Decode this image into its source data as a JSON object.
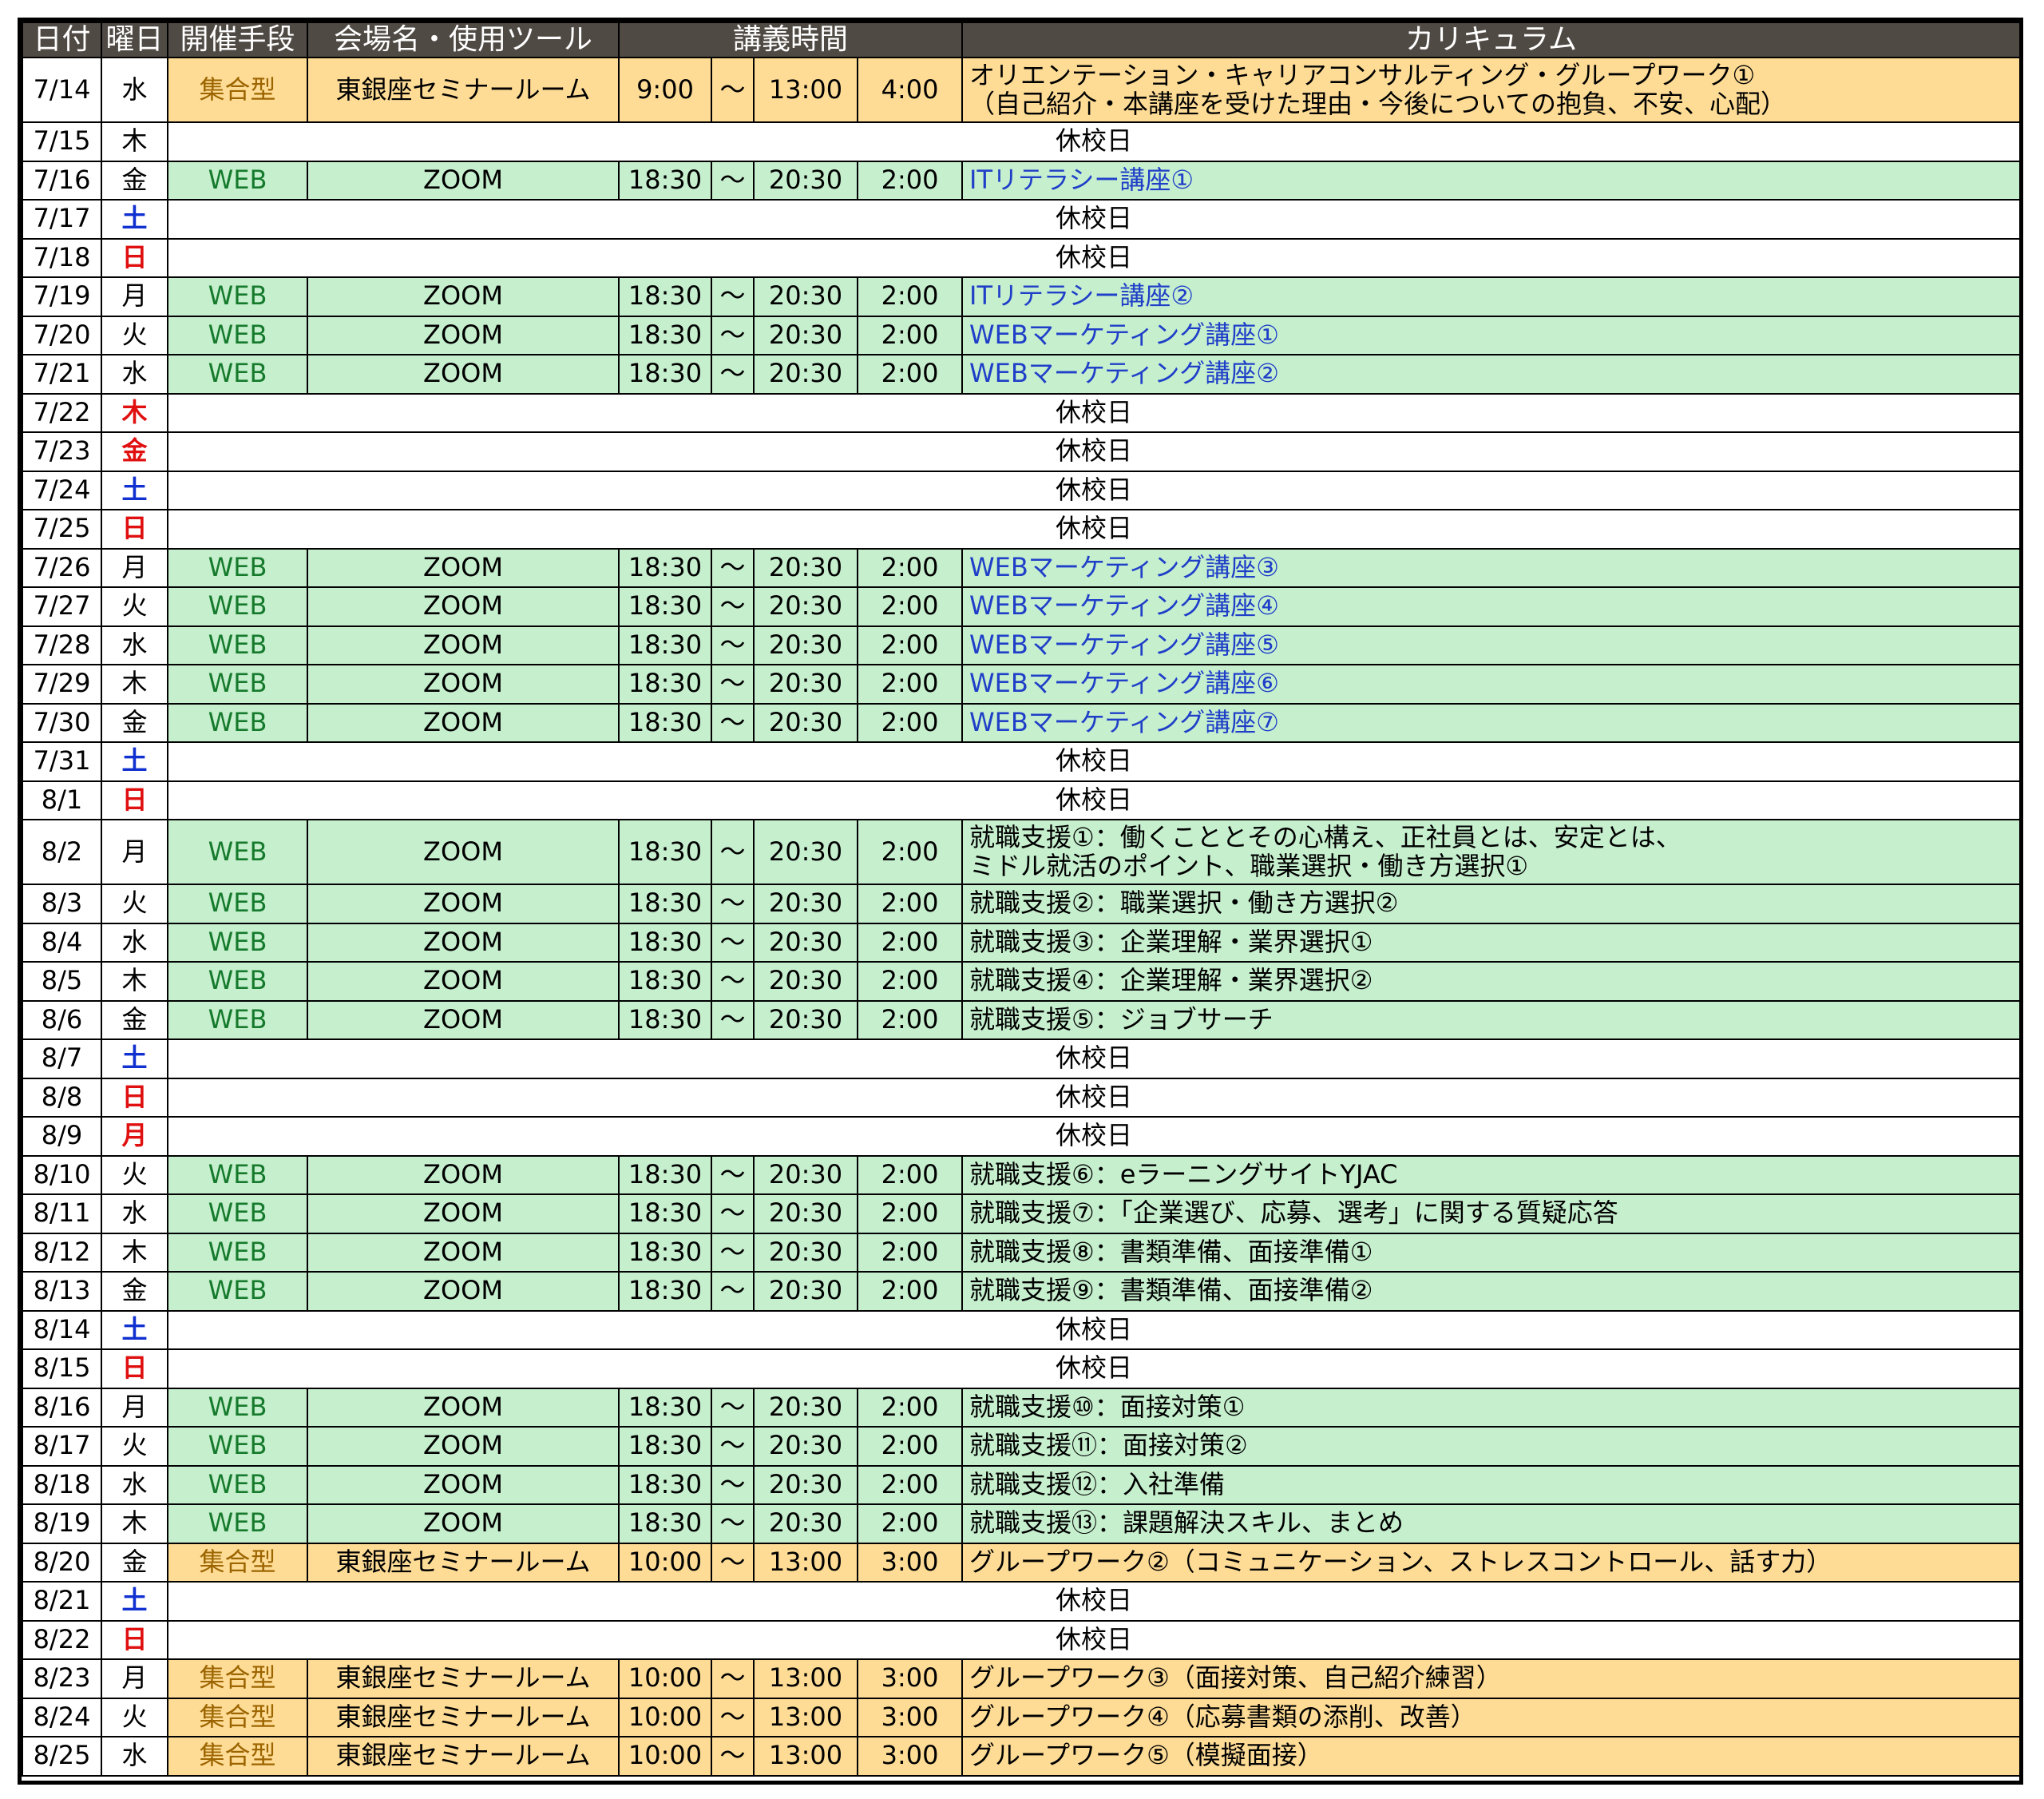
{
  "headers": {
    "date": "日付",
    "weekday": "曜日",
    "method": "開催手段",
    "venue": "会場名・使用ツール",
    "time": "講義時間",
    "curriculum": "カリキュラム"
  },
  "closed_label": "休校日",
  "tilde": "～",
  "colors": {
    "header_bg": "#504a44",
    "web_row": "#c6efce",
    "onsite_row": "#fedc96",
    "web_text": "#157a2c",
    "onsite_text": "#9c6500",
    "saturday": "#1030d0",
    "sunday_holiday": "#e01010",
    "course_link_text": "#1f3fc8"
  },
  "rows": [
    {
      "date": "7/14",
      "day": "水",
      "dayType": "weekday",
      "type": "onsite",
      "method": "集合型",
      "venue": "東銀座セミナールーム",
      "start": "9:00",
      "end": "13:00",
      "dur": "4:00",
      "cur": "オリエンテーション・キャリアコンサルティング・グループワーク①",
      "cur2": "（自己紹介・本講座を受けた理由・今後についての抱負、不安、心配）",
      "blue": false
    },
    {
      "date": "7/15",
      "day": "木",
      "dayType": "weekday",
      "type": "closed"
    },
    {
      "date": "7/16",
      "day": "金",
      "dayType": "weekday",
      "type": "web",
      "method": "WEB",
      "venue": "ZOOM",
      "start": "18:30",
      "end": "20:30",
      "dur": "2:00",
      "cur": "ITリテラシー講座①",
      "blue": true
    },
    {
      "date": "7/17",
      "day": "土",
      "dayType": "sat",
      "type": "closed"
    },
    {
      "date": "7/18",
      "day": "日",
      "dayType": "sun",
      "type": "closed"
    },
    {
      "date": "7/19",
      "day": "月",
      "dayType": "weekday",
      "type": "web",
      "method": "WEB",
      "venue": "ZOOM",
      "start": "18:30",
      "end": "20:30",
      "dur": "2:00",
      "cur": "ITリテラシー講座②",
      "blue": true
    },
    {
      "date": "7/20",
      "day": "火",
      "dayType": "weekday",
      "type": "web",
      "method": "WEB",
      "venue": "ZOOM",
      "start": "18:30",
      "end": "20:30",
      "dur": "2:00",
      "cur": "WEBマーケティング講座①",
      "blue": true
    },
    {
      "date": "7/21",
      "day": "水",
      "dayType": "weekday",
      "type": "web",
      "method": "WEB",
      "venue": "ZOOM",
      "start": "18:30",
      "end": "20:30",
      "dur": "2:00",
      "cur": "WEBマーケティング講座②",
      "blue": true
    },
    {
      "date": "7/22",
      "day": "木",
      "dayType": "holiday",
      "type": "closed"
    },
    {
      "date": "7/23",
      "day": "金",
      "dayType": "holiday",
      "type": "closed"
    },
    {
      "date": "7/24",
      "day": "土",
      "dayType": "sat",
      "type": "closed"
    },
    {
      "date": "7/25",
      "day": "日",
      "dayType": "sun",
      "type": "closed"
    },
    {
      "date": "7/26",
      "day": "月",
      "dayType": "weekday",
      "type": "web",
      "method": "WEB",
      "venue": "ZOOM",
      "start": "18:30",
      "end": "20:30",
      "dur": "2:00",
      "cur": "WEBマーケティング講座③",
      "blue": true
    },
    {
      "date": "7/27",
      "day": "火",
      "dayType": "weekday",
      "type": "web",
      "method": "WEB",
      "venue": "ZOOM",
      "start": "18:30",
      "end": "20:30",
      "dur": "2:00",
      "cur": "WEBマーケティング講座④",
      "blue": true
    },
    {
      "date": "7/28",
      "day": "水",
      "dayType": "weekday",
      "type": "web",
      "method": "WEB",
      "venue": "ZOOM",
      "start": "18:30",
      "end": "20:30",
      "dur": "2:00",
      "cur": "WEBマーケティング講座⑤",
      "blue": true
    },
    {
      "date": "7/29",
      "day": "木",
      "dayType": "weekday",
      "type": "web",
      "method": "WEB",
      "venue": "ZOOM",
      "start": "18:30",
      "end": "20:30",
      "dur": "2:00",
      "cur": "WEBマーケティング講座⑥",
      "blue": true
    },
    {
      "date": "7/30",
      "day": "金",
      "dayType": "weekday",
      "type": "web",
      "method": "WEB",
      "venue": "ZOOM",
      "start": "18:30",
      "end": "20:30",
      "dur": "2:00",
      "cur": "WEBマーケティング講座⑦",
      "blue": true
    },
    {
      "date": "7/31",
      "day": "土",
      "dayType": "sat",
      "type": "closed"
    },
    {
      "date": "8/1",
      "day": "日",
      "dayType": "sun",
      "type": "closed"
    },
    {
      "date": "8/2",
      "day": "月",
      "dayType": "weekday",
      "type": "web",
      "method": "WEB",
      "venue": "ZOOM",
      "start": "18:30",
      "end": "20:30",
      "dur": "2:00",
      "cur": "就職支援①：働くこととその心構え、正社員とは、安定とは、",
      "cur2": "ミドル就活のポイント、職業選択・働き方選択①",
      "blue": false
    },
    {
      "date": "8/3",
      "day": "火",
      "dayType": "weekday",
      "type": "web",
      "method": "WEB",
      "venue": "ZOOM",
      "start": "18:30",
      "end": "20:30",
      "dur": "2:00",
      "cur": "就職支援②：職業選択・働き方選択②",
      "blue": false
    },
    {
      "date": "8/4",
      "day": "水",
      "dayType": "weekday",
      "type": "web",
      "method": "WEB",
      "venue": "ZOOM",
      "start": "18:30",
      "end": "20:30",
      "dur": "2:00",
      "cur": "就職支援③：企業理解・業界選択①",
      "blue": false
    },
    {
      "date": "8/5",
      "day": "木",
      "dayType": "weekday",
      "type": "web",
      "method": "WEB",
      "venue": "ZOOM",
      "start": "18:30",
      "end": "20:30",
      "dur": "2:00",
      "cur": "就職支援④：企業理解・業界選択②",
      "blue": false
    },
    {
      "date": "8/6",
      "day": "金",
      "dayType": "weekday",
      "type": "web",
      "method": "WEB",
      "venue": "ZOOM",
      "start": "18:30",
      "end": "20:30",
      "dur": "2:00",
      "cur": "就職支援⑤：ジョブサーチ",
      "blue": false
    },
    {
      "date": "8/7",
      "day": "土",
      "dayType": "sat",
      "type": "closed"
    },
    {
      "date": "8/8",
      "day": "日",
      "dayType": "sun",
      "type": "closed"
    },
    {
      "date": "8/9",
      "day": "月",
      "dayType": "holiday",
      "type": "closed"
    },
    {
      "date": "8/10",
      "day": "火",
      "dayType": "weekday",
      "type": "web",
      "method": "WEB",
      "venue": "ZOOM",
      "start": "18:30",
      "end": "20:30",
      "dur": "2:00",
      "cur": "就職支援⑥：eラーニングサイトYJAC",
      "blue": false
    },
    {
      "date": "8/11",
      "day": "水",
      "dayType": "weekday",
      "type": "web",
      "method": "WEB",
      "venue": "ZOOM",
      "start": "18:30",
      "end": "20:30",
      "dur": "2:00",
      "cur": "就職支援⑦：「企業選び、応募、選考」に関する質疑応答",
      "blue": false
    },
    {
      "date": "8/12",
      "day": "木",
      "dayType": "weekday",
      "type": "web",
      "method": "WEB",
      "venue": "ZOOM",
      "start": "18:30",
      "end": "20:30",
      "dur": "2:00",
      "cur": "就職支援⑧：書類準備、面接準備①",
      "blue": false
    },
    {
      "date": "8/13",
      "day": "金",
      "dayType": "weekday",
      "type": "web",
      "method": "WEB",
      "venue": "ZOOM",
      "start": "18:30",
      "end": "20:30",
      "dur": "2:00",
      "cur": "就職支援⑨：書類準備、面接準備②",
      "blue": false
    },
    {
      "date": "8/14",
      "day": "土",
      "dayType": "sat",
      "type": "closed"
    },
    {
      "date": "8/15",
      "day": "日",
      "dayType": "sun",
      "type": "closed"
    },
    {
      "date": "8/16",
      "day": "月",
      "dayType": "weekday",
      "type": "web",
      "method": "WEB",
      "venue": "ZOOM",
      "start": "18:30",
      "end": "20:30",
      "dur": "2:00",
      "cur": "就職支援⑩：面接対策①",
      "blue": false
    },
    {
      "date": "8/17",
      "day": "火",
      "dayType": "weekday",
      "type": "web",
      "method": "WEB",
      "venue": "ZOOM",
      "start": "18:30",
      "end": "20:30",
      "dur": "2:00",
      "cur": "就職支援⑪：面接対策②",
      "blue": false
    },
    {
      "date": "8/18",
      "day": "水",
      "dayType": "weekday",
      "type": "web",
      "method": "WEB",
      "venue": "ZOOM",
      "start": "18:30",
      "end": "20:30",
      "dur": "2:00",
      "cur": "就職支援⑫：入社準備",
      "blue": false
    },
    {
      "date": "8/19",
      "day": "木",
      "dayType": "weekday",
      "type": "web",
      "method": "WEB",
      "venue": "ZOOM",
      "start": "18:30",
      "end": "20:30",
      "dur": "2:00",
      "cur": "就職支援⑬：課題解決スキル、まとめ",
      "blue": false
    },
    {
      "date": "8/20",
      "day": "金",
      "dayType": "weekday",
      "type": "onsite",
      "method": "集合型",
      "venue": "東銀座セミナールーム",
      "start": "10:00",
      "end": "13:00",
      "dur": "3:00",
      "cur": "グループワーク②（コミュニケーション、ストレスコントロール、話す力）",
      "blue": false
    },
    {
      "date": "8/21",
      "day": "土",
      "dayType": "sat",
      "type": "closed"
    },
    {
      "date": "8/22",
      "day": "日",
      "dayType": "sun",
      "type": "closed"
    },
    {
      "date": "8/23",
      "day": "月",
      "dayType": "weekday",
      "type": "onsite",
      "method": "集合型",
      "venue": "東銀座セミナールーム",
      "start": "10:00",
      "end": "13:00",
      "dur": "3:00",
      "cur": "グループワーク③（面接対策、自己紹介練習）",
      "blue": false
    },
    {
      "date": "8/24",
      "day": "火",
      "dayType": "weekday",
      "type": "onsite",
      "method": "集合型",
      "venue": "東銀座セミナールーム",
      "start": "10:00",
      "end": "13:00",
      "dur": "3:00",
      "cur": "グループワーク④（応募書類の添削、改善）",
      "blue": false
    },
    {
      "date": "8/25",
      "day": "水",
      "dayType": "weekday",
      "type": "onsite",
      "method": "集合型",
      "venue": "東銀座セミナールーム",
      "start": "10:00",
      "end": "13:00",
      "dur": "3:00",
      "cur": "グループワーク⑤（模擬面接）",
      "blue": false
    }
  ]
}
